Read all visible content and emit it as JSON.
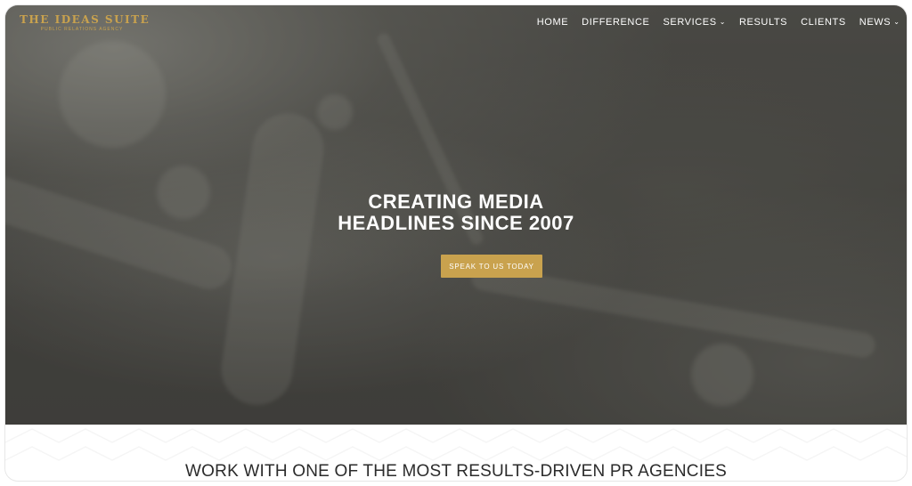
{
  "brand": {
    "name": "THE IDEAS SUITE",
    "tagline": "PUBLIC RELATIONS AGENCY",
    "accent_color": "#c9a24e"
  },
  "nav": {
    "items": [
      {
        "label": "HOME",
        "has_dropdown": false
      },
      {
        "label": "DIFFERENCE",
        "has_dropdown": false
      },
      {
        "label": "SERVICES",
        "has_dropdown": true
      },
      {
        "label": "RESULTS",
        "has_dropdown": false
      },
      {
        "label": "CLIENTS",
        "has_dropdown": false
      },
      {
        "label": "NEWS",
        "has_dropdown": true
      }
    ],
    "dropdown_icon": "chevron-down-icon"
  },
  "hero": {
    "headline_line1": "CREATING MEDIA",
    "headline_line2": "HEADLINES SINCE 2007",
    "cta_label": "SPEAK TO US TODAY"
  },
  "section": {
    "title": "WORK WITH ONE OF THE MOST RESULTS-DRIVEN PR AGENCIES"
  }
}
